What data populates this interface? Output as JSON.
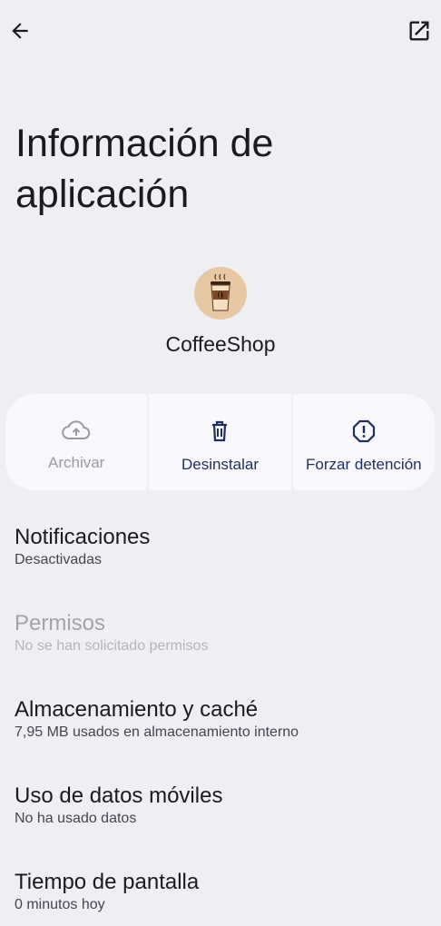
{
  "header": {
    "back_icon": "arrow-back-icon",
    "open_icon": "open-in-new-icon"
  },
  "page": {
    "title": "Información de aplicación"
  },
  "app": {
    "icon": "coffee-cup-icon",
    "name": "CoffeeShop"
  },
  "actions": [
    {
      "label": "Archivar",
      "icon": "cloud-upload-icon",
      "enabled": false
    },
    {
      "label": "Desinstalar",
      "icon": "trash-icon",
      "enabled": true
    },
    {
      "label": "Forzar detención",
      "icon": "alert-octagon-icon",
      "enabled": true
    }
  ],
  "settings": [
    {
      "title": "Notificaciones",
      "subtitle": "Desactivadas",
      "enabled": true
    },
    {
      "title": "Permisos",
      "subtitle": "No se han solicitado permisos",
      "enabled": false
    },
    {
      "title": "Almacenamiento y caché",
      "subtitle": "7,95 MB usados en almacenamiento interno",
      "enabled": true
    },
    {
      "title": "Uso de datos móviles",
      "subtitle": "No ha usado datos",
      "enabled": true
    },
    {
      "title": "Tiempo de pantalla",
      "subtitle": "0 minutos hoy",
      "enabled": true
    }
  ],
  "colors": {
    "background": "#eeeef3",
    "accent": "#1f2f5c",
    "disabled": "#9a9aa2"
  }
}
